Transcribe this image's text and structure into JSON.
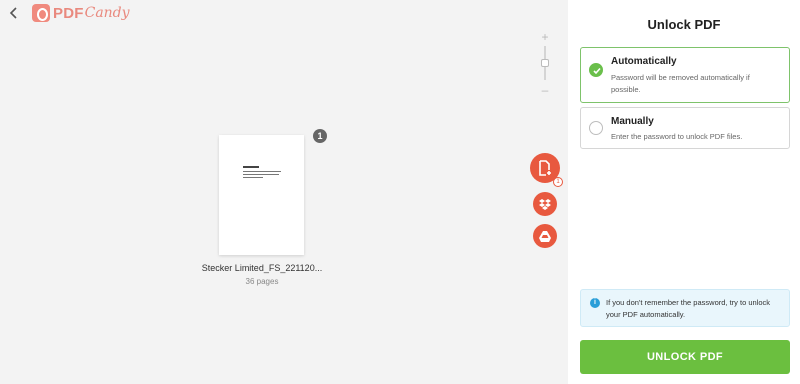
{
  "header": {
    "back_icon": "chevron-left-icon",
    "logo_pdf": "PDF",
    "logo_candy": "Candy"
  },
  "zoom": {
    "plus": "+",
    "minus": "–"
  },
  "document": {
    "name": "Stecker Limited_FS_221120...",
    "pages": "36 pages",
    "count_badge": "1"
  },
  "upload": {
    "add_file_icon": "add-file-icon",
    "dropbox_icon": "dropbox-icon",
    "drive_icon": "google-drive-icon",
    "add_badge": "1"
  },
  "panel": {
    "title": "Unlock PDF",
    "options": [
      {
        "title": "Automatically",
        "description": "Password will be removed automatically if possible.",
        "selected": true
      },
      {
        "title": "Manually",
        "description": "Enter the password to unlock PDF files.",
        "selected": false
      }
    ],
    "info_text": "If you don't remember the password, try to unlock your PDF automatically.",
    "unlock_label": "UNLOCK PDF"
  },
  "colors": {
    "accent": "#e8593f",
    "success": "#6bbf3f",
    "brand": "#e9897e",
    "info": "#2a9ed8"
  }
}
